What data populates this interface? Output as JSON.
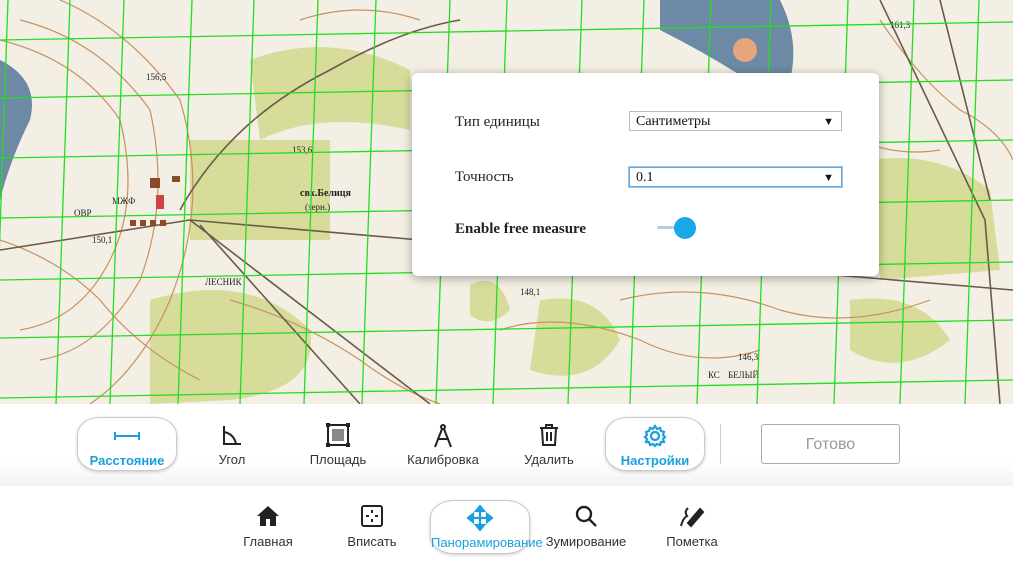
{
  "settings": {
    "unit_type_label": "Тип единицы",
    "unit_type_value": "Сантиметры",
    "precision_label": "Точность",
    "precision_value": "0.1",
    "free_measure_label": "Enable free measure",
    "free_measure_enabled": true,
    "arrow": "▼"
  },
  "toolbar": {
    "distance": "Расстояние",
    "angle": "Угол",
    "area": "Площадь",
    "calibration": "Калибровка",
    "delete": "Удалить",
    "settings": "Настройки",
    "done": "Готово"
  },
  "nav": {
    "home": "Главная",
    "fit": "Вписать",
    "pan": "Панорамирование",
    "zoom": "Зумирование",
    "markup": "Пометка"
  },
  "map": {
    "village_label": "свх.Белиця",
    "village_sub": "(зерн.)",
    "elev_1": "156,5",
    "elev_2": "153,6",
    "elev_3": "150,1",
    "elev_4": "148,1",
    "elev_5": "146,3",
    "elev_6": "161,3",
    "label_1": "МЖФ",
    "label_2": "ЛЕСНИК",
    "label_3": "КС",
    "label_4": "ОВР",
    "label_5": "БЕЛЫЙ"
  },
  "colors": {
    "accent": "#1aa7e8",
    "grid": "#22dd22",
    "field": "#d7dc9a",
    "map_bg": "#f4efe4",
    "water": "#6c8aa6",
    "contour": "#c9915f"
  }
}
